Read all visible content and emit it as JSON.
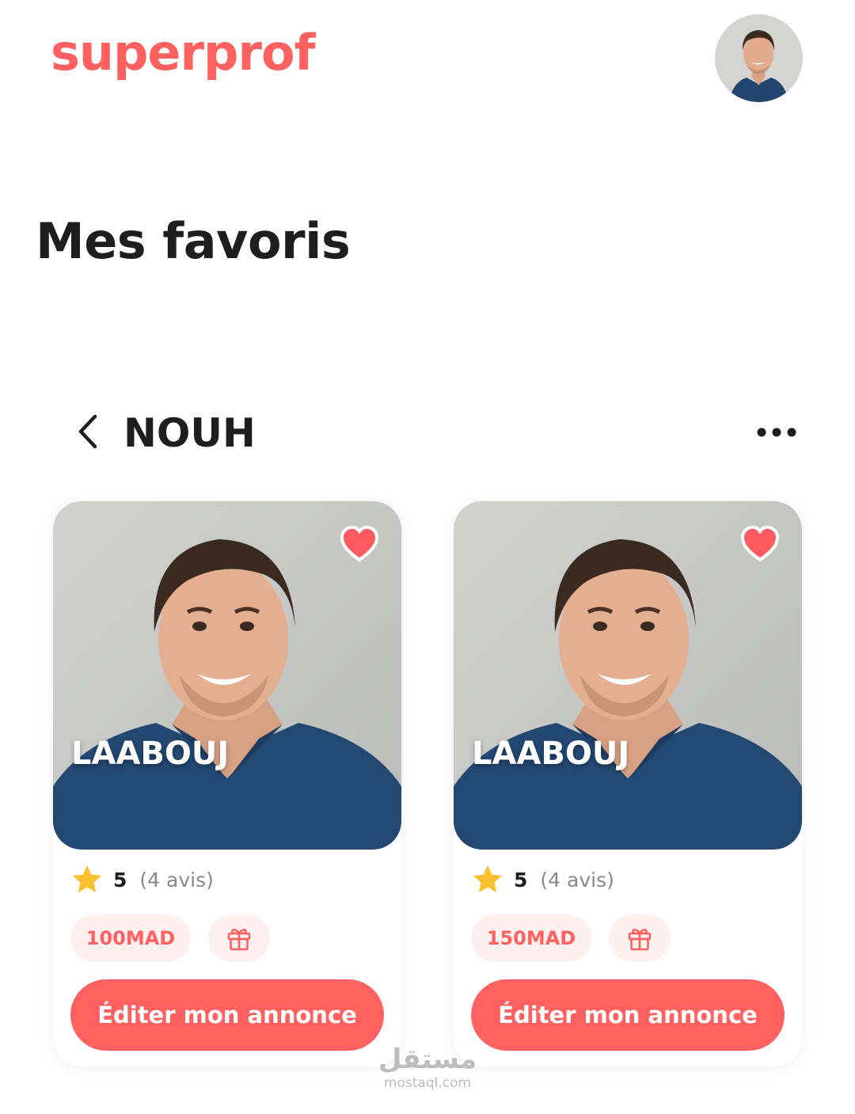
{
  "header": {
    "logo": "superprof"
  },
  "page": {
    "title": "Mes favoris"
  },
  "section": {
    "title": "NOUH",
    "back_icon": "chevron-left-icon",
    "more_icon": "more-horizontal-icon"
  },
  "cards": [
    {
      "name": "LAABOUJ",
      "rating": "5",
      "reviews": "(4 avis)",
      "price": "100MAD",
      "favorite": true,
      "action": "Éditer mon annonce"
    },
    {
      "name": "LAABOUJ",
      "rating": "5",
      "reviews": "(4 avis)",
      "price": "150MAD",
      "favorite": true,
      "action": "Éditer mon annonce"
    }
  ],
  "watermark": {
    "arabic": "مستقل",
    "url": "mostaql.com"
  },
  "colors": {
    "brand": "#ff6161",
    "badge_bg": "#fff0f0",
    "star": "#fbc02d",
    "text": "#1e1e1e",
    "muted": "#8a8a8a"
  }
}
